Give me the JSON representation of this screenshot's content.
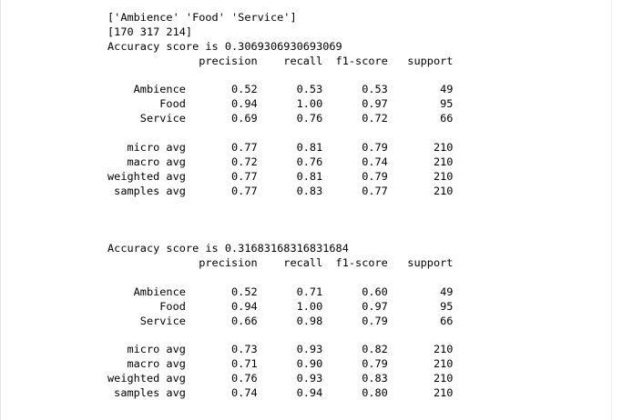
{
  "output": {
    "lines": [
      "['Ambience' 'Food' 'Service']",
      "[170 317 214]",
      "Accuracy score is 0.3069306930693069",
      "              precision    recall  f1-score   support",
      "",
      "    Ambience       0.52      0.53      0.53        49",
      "        Food       0.94      1.00      0.97        95",
      "     Service       0.69      0.76      0.72        66",
      "",
      "   micro avg       0.77      0.81      0.79       210",
      "   macro avg       0.72      0.76      0.74       210",
      "weighted avg       0.77      0.81      0.79       210",
      " samples avg       0.77      0.83      0.77       210",
      "",
      "",
      "",
      "Accuracy score is 0.31683168316831684",
      "              precision    recall  f1-score   support",
      "",
      "    Ambience       0.52      0.71      0.60        49",
      "        Food       0.94      1.00      0.97        95",
      "     Service       0.66      0.98      0.79        66",
      "",
      "   micro avg       0.73      0.93      0.82       210",
      "   macro avg       0.71      0.90      0.79       210",
      "weighted avg       0.76      0.93      0.83       210",
      " samples avg       0.74      0.94      0.80       210"
    ]
  }
}
